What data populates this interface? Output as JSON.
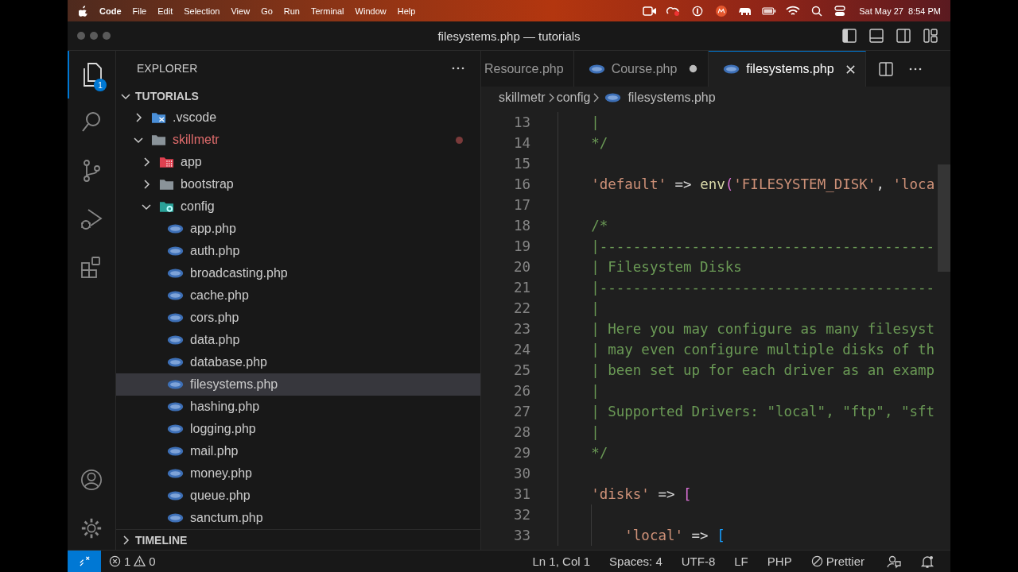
{
  "menu_bar": {
    "menus": [
      "Code",
      "File",
      "Edit",
      "Selection",
      "View",
      "Go",
      "Run",
      "Terminal",
      "Window",
      "Help"
    ],
    "clock": "Sat May 27  8:54 PM"
  },
  "window": {
    "title": "filesystems.php — tutorials"
  },
  "activity_bar": {
    "explorer_badge": "1"
  },
  "sidebar": {
    "title": "EXPLORER",
    "root": {
      "label": "TUTORIALS",
      "expanded": true
    },
    "tree": [
      {
        "name": ".vscode",
        "kind": "vscode",
        "expanded": false,
        "selected": false,
        "modified": false
      },
      {
        "name": "skillmetr",
        "kind": "folder",
        "expanded": true,
        "selected": false,
        "modified": true,
        "children": [
          {
            "name": "app",
            "kind": "app",
            "expanded": false,
            "selected": false,
            "modified": false
          },
          {
            "name": "bootstrap",
            "kind": "folder",
            "expanded": false,
            "selected": false,
            "modified": false
          },
          {
            "name": "config",
            "kind": "config",
            "expanded": true,
            "selected": false,
            "modified": false,
            "children": [
              {
                "name": "app.php",
                "kind": "php",
                "selected": false,
                "modified": false
              },
              {
                "name": "auth.php",
                "kind": "php",
                "selected": false,
                "modified": false
              },
              {
                "name": "broadcasting.php",
                "kind": "php",
                "selected": false,
                "modified": false
              },
              {
                "name": "cache.php",
                "kind": "php",
                "selected": false,
                "modified": false
              },
              {
                "name": "cors.php",
                "kind": "php",
                "selected": false,
                "modified": false
              },
              {
                "name": "data.php",
                "kind": "php",
                "selected": false,
                "modified": false
              },
              {
                "name": "database.php",
                "kind": "php",
                "selected": false,
                "modified": false
              },
              {
                "name": "filesystems.php",
                "kind": "php",
                "selected": true,
                "modified": false
              },
              {
                "name": "hashing.php",
                "kind": "php",
                "selected": false,
                "modified": false
              },
              {
                "name": "logging.php",
                "kind": "php",
                "selected": false,
                "modified": false
              },
              {
                "name": "mail.php",
                "kind": "php",
                "selected": false,
                "modified": false
              },
              {
                "name": "money.php",
                "kind": "php",
                "selected": false,
                "modified": false
              },
              {
                "name": "queue.php",
                "kind": "php",
                "selected": false,
                "modified": false
              },
              {
                "name": "sanctum.php",
                "kind": "php",
                "selected": false,
                "modified": false
              }
            ]
          }
        ]
      }
    ],
    "timeline": {
      "label": "TIMELINE",
      "expanded": false
    }
  },
  "tabs": [
    {
      "label": "Resource.php",
      "selected": false,
      "dirty": false,
      "icon": false
    },
    {
      "label": "Course.php",
      "selected": false,
      "dirty": true,
      "icon": true
    },
    {
      "label": "filesystems.php",
      "selected": true,
      "dirty": false,
      "icon": true
    }
  ],
  "breadcrumb": [
    "skillmetr",
    "config",
    "filesystems.php"
  ],
  "code": [
    {
      "number": "13",
      "tokens": [
        {
          "kind": "comment",
          "text": "|"
        }
      ]
    },
    {
      "number": "14",
      "tokens": [
        {
          "kind": "comment",
          "text": "*/"
        }
      ]
    },
    {
      "number": "15"
    },
    {
      "number": "16",
      "tokens": [
        {
          "kind": "string",
          "text": "'default'"
        },
        {
          "kind": "plain",
          "text": " => "
        },
        {
          "kind": "function",
          "text": "env"
        },
        {
          "kind": "bracket",
          "text": "("
        },
        {
          "kind": "string",
          "text": "'FILESYSTEM_DISK'"
        },
        {
          "kind": "plain",
          "text": ", "
        },
        {
          "kind": "string",
          "text": "'loca"
        }
      ]
    },
    {
      "number": "17"
    },
    {
      "number": "18",
      "tokens": [
        {
          "kind": "comment",
          "text": "/*"
        }
      ]
    },
    {
      "number": "19",
      "tokens": [
        {
          "kind": "comment",
          "text": "|----------------------------------------"
        }
      ]
    },
    {
      "number": "20",
      "tokens": [
        {
          "kind": "comment",
          "text": "| Filesystem Disks"
        }
      ]
    },
    {
      "number": "21",
      "tokens": [
        {
          "kind": "comment",
          "text": "|----------------------------------------"
        }
      ]
    },
    {
      "number": "22",
      "tokens": [
        {
          "kind": "comment",
          "text": "|"
        }
      ]
    },
    {
      "number": "23",
      "tokens": [
        {
          "kind": "comment",
          "text": "| Here you may configure as many filesyst"
        }
      ]
    },
    {
      "number": "24",
      "tokens": [
        {
          "kind": "comment",
          "text": "| may even configure multiple disks of th"
        }
      ]
    },
    {
      "number": "25",
      "tokens": [
        {
          "kind": "comment",
          "text": "| been set up for each driver as an examp"
        }
      ]
    },
    {
      "number": "26",
      "tokens": [
        {
          "kind": "comment",
          "text": "|"
        }
      ]
    },
    {
      "number": "27",
      "tokens": [
        {
          "kind": "comment",
          "text": "| Supported Drivers: \"local\", \"ftp\", \"sft"
        }
      ]
    },
    {
      "number": "28",
      "tokens": [
        {
          "kind": "comment",
          "text": "|"
        }
      ]
    },
    {
      "number": "29",
      "tokens": [
        {
          "kind": "comment",
          "text": "*/"
        }
      ]
    },
    {
      "number": "30"
    },
    {
      "number": "31",
      "tokens": [
        {
          "kind": "string",
          "text": "'disks'"
        },
        {
          "kind": "plain",
          "text": " => "
        },
        {
          "kind": "bracket",
          "text": "["
        }
      ],
      "children": [
        {
          "number": "32"
        },
        {
          "number": "33",
          "tokens": [
            {
              "kind": "string",
              "text": "'local'"
            },
            {
              "kind": "plain",
              "text": " => "
            },
            {
              "kind": "inner-bracket",
              "text": "["
            }
          ]
        }
      ]
    }
  ],
  "status_bar": {
    "errors": "1",
    "warnings": "0",
    "items": [
      "Ln 1, Col 1",
      "Spaces: 4",
      "UTF-8",
      "LF",
      "PHP"
    ],
    "formatter": "Prettier"
  }
}
